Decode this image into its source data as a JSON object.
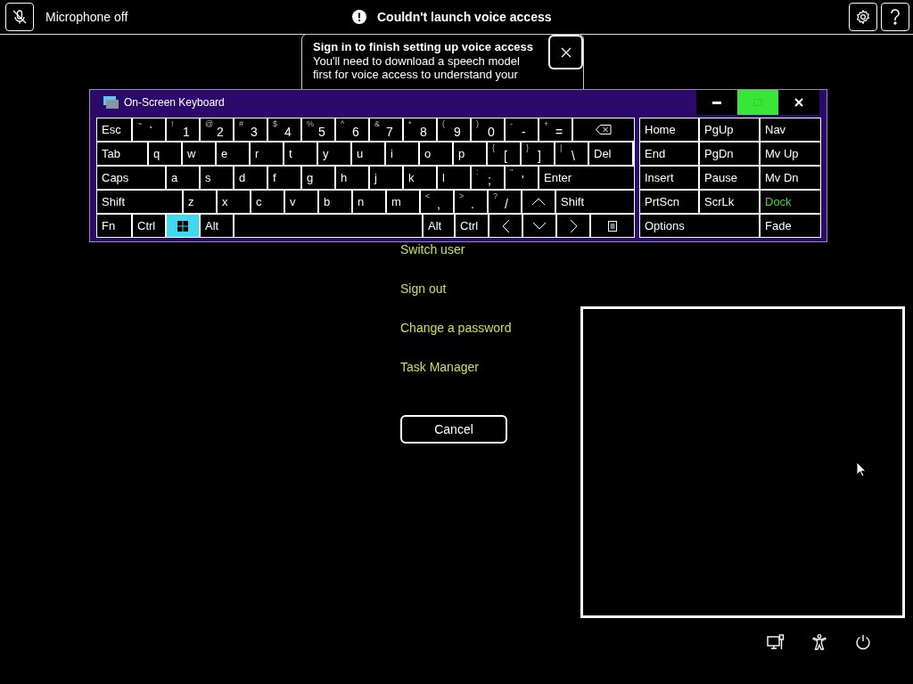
{
  "top_bar": {
    "mic_label": "Microphone off",
    "alert": "Couldn't launch voice access"
  },
  "popup": {
    "title": "Sign in to finish setting up voice access",
    "body": "You'll need to download a speech model first for voice access to understand your"
  },
  "keyboard": {
    "title": "On-Screen Keyboard",
    "title_buttons": [
      {
        "kind": "minimize",
        "hovered": false
      },
      {
        "kind": "maximize",
        "hovered": true
      },
      {
        "kind": "close",
        "hovered": false
      }
    ],
    "rows": [
      [
        {
          "kind": "text",
          "label": "Esc",
          "on": false
        },
        {
          "kind": "text",
          "shift": "~",
          "label": "`",
          "on": false
        },
        {
          "kind": "text",
          "shift": "!",
          "label": "1",
          "on": false
        },
        {
          "kind": "text",
          "shift": "@",
          "label": "2",
          "on": false
        },
        {
          "kind": "text",
          "shift": "#",
          "label": "3",
          "on": false
        },
        {
          "kind": "text",
          "shift": "$",
          "label": "4",
          "on": false
        },
        {
          "kind": "text",
          "shift": "%",
          "label": "5",
          "on": false
        },
        {
          "kind": "text",
          "shift": "^",
          "label": "6",
          "on": false
        },
        {
          "kind": "text",
          "shift": "&",
          "label": "7",
          "on": false
        },
        {
          "kind": "text",
          "shift": "*",
          "label": "8",
          "on": false
        },
        {
          "kind": "text",
          "shift": "(",
          "label": "9",
          "on": false
        },
        {
          "kind": "text",
          "shift": ")",
          "label": "0",
          "on": false
        },
        {
          "kind": "text",
          "shift": "-",
          "label": "-",
          "on": false
        },
        {
          "kind": "text",
          "shift": "+",
          "label": "=",
          "on": false
        },
        {
          "kind": "backspace",
          "on": false
        }
      ],
      [
        {
          "kind": "text",
          "label": "Tab",
          "on": false
        },
        {
          "kind": "text",
          "label": "q",
          "on": false
        },
        {
          "kind": "text",
          "label": "w",
          "on": false
        },
        {
          "kind": "text",
          "label": "e",
          "on": false
        },
        {
          "kind": "text",
          "label": "r",
          "on": false
        },
        {
          "kind": "text",
          "label": "t",
          "on": false
        },
        {
          "kind": "text",
          "label": "y",
          "on": false
        },
        {
          "kind": "text",
          "label": "u",
          "on": false
        },
        {
          "kind": "text",
          "label": "i",
          "on": false
        },
        {
          "kind": "text",
          "label": "o",
          "on": false
        },
        {
          "kind": "text",
          "label": "p",
          "on": false
        },
        {
          "kind": "text",
          "shift": "{",
          "label": "[",
          "on": false
        },
        {
          "kind": "text",
          "shift": "}",
          "label": "]",
          "on": false
        },
        {
          "kind": "text",
          "shift": "|",
          "label": "\\",
          "on": false
        },
        {
          "kind": "text",
          "label": "Del",
          "on": false
        }
      ],
      [
        {
          "kind": "text",
          "label": "Caps",
          "on": false
        },
        {
          "kind": "text",
          "label": "a",
          "on": false
        },
        {
          "kind": "text",
          "label": "s",
          "on": false
        },
        {
          "kind": "text",
          "label": "d",
          "on": false
        },
        {
          "kind": "text",
          "label": "f",
          "on": false
        },
        {
          "kind": "text",
          "label": "g",
          "on": false
        },
        {
          "kind": "text",
          "label": "h",
          "on": false
        },
        {
          "kind": "text",
          "label": "j",
          "on": false
        },
        {
          "kind": "text",
          "label": "k",
          "on": false
        },
        {
          "kind": "text",
          "label": "l",
          "on": false
        },
        {
          "kind": "text",
          "shift": ":",
          "label": ";",
          "on": false
        },
        {
          "kind": "text",
          "shift": "\"",
          "label": "'",
          "on": false
        },
        {
          "kind": "text",
          "label": "Enter",
          "on": false
        }
      ],
      [
        {
          "kind": "text",
          "label": "Shift",
          "on": false
        },
        {
          "kind": "text",
          "label": "z",
          "on": false
        },
        {
          "kind": "text",
          "label": "x",
          "on": false
        },
        {
          "kind": "text",
          "label": "c",
          "on": false
        },
        {
          "kind": "text",
          "label": "v",
          "on": false
        },
        {
          "kind": "text",
          "label": "b",
          "on": false
        },
        {
          "kind": "text",
          "label": "n",
          "on": false
        },
        {
          "kind": "text",
          "label": "m",
          "on": false
        },
        {
          "kind": "text",
          "shift": "<",
          "label": ",",
          "on": false
        },
        {
          "kind": "text",
          "shift": ">",
          "label": ".",
          "on": false
        },
        {
          "kind": "text",
          "shift": "?",
          "label": "/",
          "on": false
        },
        {
          "kind": "up",
          "on": false
        },
        {
          "kind": "text",
          "label": "Shift",
          "on": false
        }
      ],
      [
        {
          "kind": "text",
          "label": "Fn",
          "on": false
        },
        {
          "kind": "text",
          "label": "Ctrl",
          "on": false
        },
        {
          "kind": "windows",
          "on": true
        },
        {
          "kind": "text",
          "label": "Alt",
          "on": false
        },
        {
          "kind": "space",
          "on": false
        },
        {
          "kind": "text",
          "label": "Alt",
          "on": false
        },
        {
          "kind": "text",
          "label": "Ctrl",
          "on": false
        },
        {
          "kind": "left",
          "on": false
        },
        {
          "kind": "down",
          "on": false
        },
        {
          "kind": "right",
          "on": false
        },
        {
          "kind": "menu",
          "on": false
        }
      ]
    ],
    "nav_rows": [
      [
        {
          "label": "Home",
          "on": false
        },
        {
          "label": "PgUp",
          "on": false
        },
        {
          "label": "Nav",
          "on": false
        }
      ],
      [
        {
          "label": "End",
          "on": false
        },
        {
          "label": "PgDn",
          "on": false
        },
        {
          "label": "Mv Up",
          "on": false
        }
      ],
      [
        {
          "label": "Insert",
          "on": false
        },
        {
          "label": "Pause",
          "on": false
        },
        {
          "label": "Mv Dn",
          "on": false
        }
      ],
      [
        {
          "label": "PrtScn",
          "on": false
        },
        {
          "label": "ScrLk",
          "on": false
        },
        {
          "label": "Dock",
          "on": true
        }
      ],
      [
        {
          "label": "Options",
          "on": false
        },
        {
          "label": "Fade",
          "on": false
        }
      ]
    ]
  },
  "menu": [
    "Switch user",
    "Sign out",
    "Change a password",
    "Task Manager"
  ],
  "cancel": "Cancel"
}
